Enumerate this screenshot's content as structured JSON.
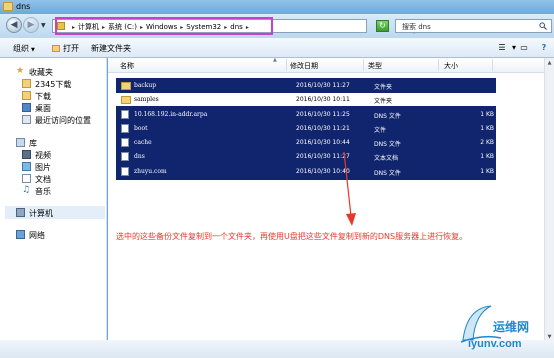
{
  "window": {
    "title": "dns"
  },
  "address": {
    "crumbs": [
      "计算机",
      "系统 (C:)",
      "Windows",
      "System32",
      "dns"
    ]
  },
  "search": {
    "placeholder": "搜索 dns"
  },
  "toolbar": {
    "organize": "组织",
    "open": "打开",
    "new_folder": "新建文件夹"
  },
  "nav": {
    "favorites": "收藏夹",
    "fav_items": [
      "2345下载",
      "下载",
      "桌面",
      "最近访问的位置"
    ],
    "libraries": "库",
    "lib_items": [
      "视频",
      "图片",
      "文档",
      "音乐"
    ],
    "computer": "计算机",
    "network": "网络"
  },
  "columns": {
    "name": "名称",
    "date": "修改日期",
    "type": "类型",
    "size": "大小"
  },
  "files": [
    {
      "name": "backup",
      "date": "2016/10/30 11:27",
      "type": "文件夹",
      "size": "",
      "kind": "folder",
      "selected": true
    },
    {
      "name": "samples",
      "date": "2016/10/30 10:11",
      "type": "文件夹",
      "size": "",
      "kind": "folder",
      "selected": false
    },
    {
      "name": "10.168.192.in-addr.arpa",
      "date": "2016/10/30 11:25",
      "type": "DNS 文件",
      "size": "1 KB",
      "kind": "file",
      "selected": true
    },
    {
      "name": "boot",
      "date": "2016/10/30 11:21",
      "type": "文件",
      "size": "1 KB",
      "kind": "file",
      "selected": true
    },
    {
      "name": "cache",
      "date": "2016/10/30 10:44",
      "type": "DNS 文件",
      "size": "2 KB",
      "kind": "file",
      "selected": true
    },
    {
      "name": "dns",
      "date": "2016/10/30 11:27",
      "type": "文本文档",
      "size": "1 KB",
      "kind": "file",
      "selected": true
    },
    {
      "name": "zhuyu.com",
      "date": "2016/10/30 10:40",
      "type": "DNS 文件",
      "size": "1 KB",
      "kind": "file",
      "selected": true
    }
  ],
  "annotation": "选中的这些备份文件复制到一个文件夹，再使用U盘把这些文件复制到新的DNS服务器上进行恢复。",
  "watermark": {
    "cn": "运维网",
    "url": "iyunv.com"
  },
  "colors": {
    "selection": "#10256e",
    "annotation": "#e8382b",
    "highlight_box": "#c83fd2",
    "watermark": "#1f88c9"
  }
}
